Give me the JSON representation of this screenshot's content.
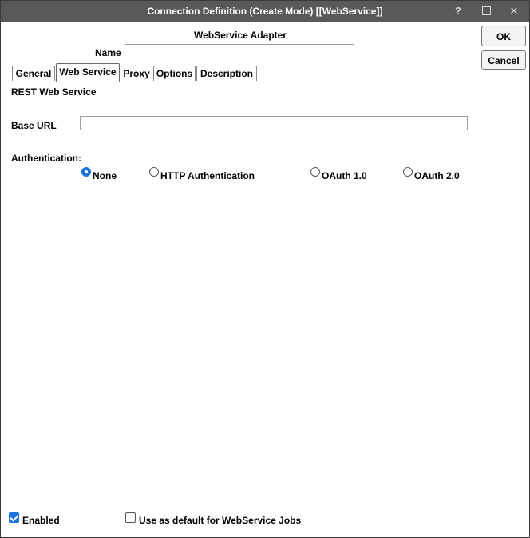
{
  "window": {
    "title": "Connection Definition (Create Mode) [[WebService]]",
    "help_glyph": "?",
    "close_glyph": "✕"
  },
  "header": {
    "adapter_title": "WebService Adapter",
    "name_label": "Name",
    "name_value": ""
  },
  "tabs": [
    {
      "label": "General",
      "active": false
    },
    {
      "label": "Web Service",
      "active": true
    },
    {
      "label": "Proxy",
      "active": false
    },
    {
      "label": "Options",
      "active": false
    },
    {
      "label": "Description",
      "active": false
    }
  ],
  "web_service": {
    "section_heading": "REST Web Service",
    "base_url_label": "Base URL",
    "base_url_value": "",
    "auth_label": "Authentication:",
    "auth_options": [
      {
        "label": "None",
        "selected": true
      },
      {
        "label": "HTTP Authentication",
        "selected": false
      },
      {
        "label": "OAuth 1.0",
        "selected": false
      },
      {
        "label": "OAuth 2.0",
        "selected": false
      }
    ]
  },
  "buttons": {
    "ok": "OK",
    "cancel": "Cancel"
  },
  "footer": {
    "enabled_label": "Enabled",
    "enabled_checked": true,
    "default_label": "Use as default for WebService Jobs",
    "default_checked": false
  },
  "colors": {
    "titlebar": "#595959",
    "accent": "#1a73e8"
  }
}
